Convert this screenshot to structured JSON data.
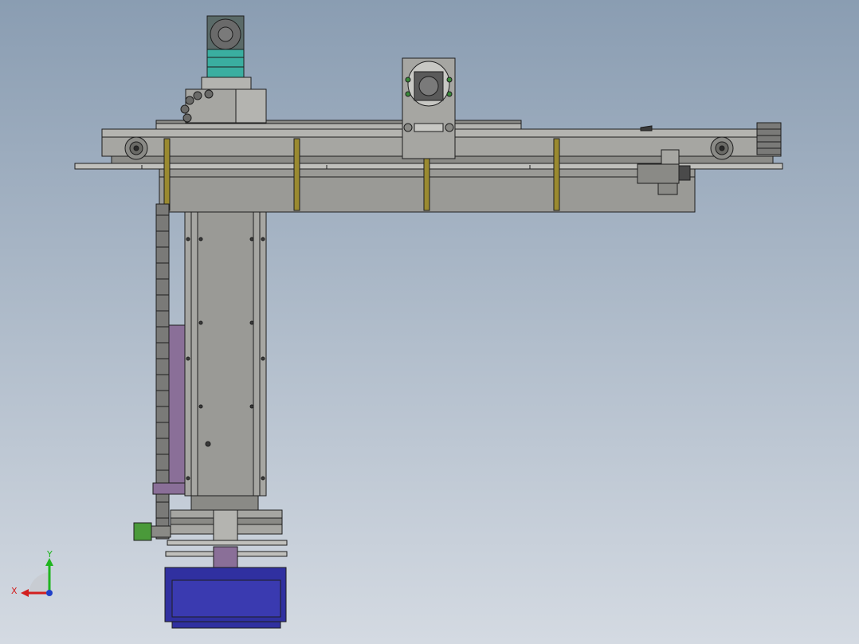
{
  "viewport": {
    "background_top": "#8a9db2",
    "background_bottom": "#d4dae2"
  },
  "triad": {
    "x_label": "X",
    "y_label": "Y",
    "x_color": "#d21f1f",
    "y_color": "#1fb51f",
    "z_color": "#2040c8"
  },
  "colors": {
    "frame_gray": "#9a9a96",
    "frame_light": "#b4b4b0",
    "edge": "#1e1e1e",
    "motor_teal": "#3aaea0",
    "motor_dark": "#5a5a5a",
    "brass": "#9a8a30",
    "purple": "#8a6f98",
    "green": "#4a9a3a",
    "navy": "#3030a0"
  }
}
